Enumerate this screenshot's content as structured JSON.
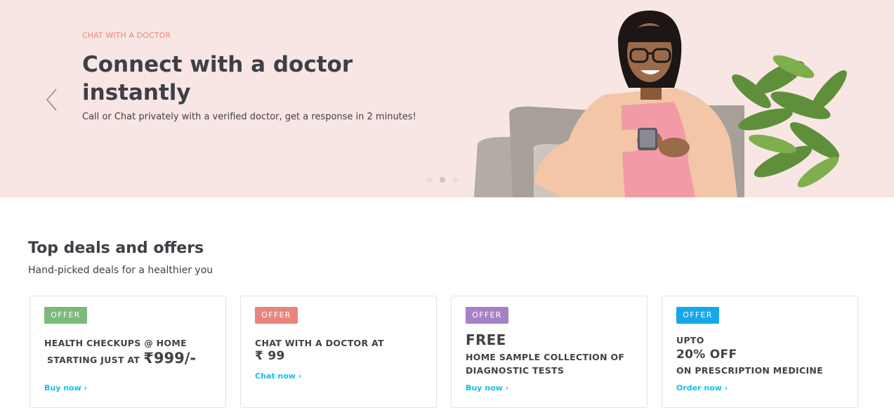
{
  "hero": {
    "eyebrow": "CHAT WITH A DOCTOR",
    "title": "Connect with a doctor instantly",
    "subtitle": "Call or Chat privately with a verified doctor, get a response in 2 minutes!",
    "prev_icon": "chevron-left-icon",
    "slides": 3,
    "active_slide": 2,
    "colors": {
      "background": "#f8e6e4",
      "eyebrow": "#e8867d"
    }
  },
  "deals": {
    "title": "Top deals and offers",
    "subtitle": "Hand-picked deals for a healthier you",
    "cards": [
      {
        "badge": "OFFER",
        "badge_color": "#7cb97c",
        "line1": "HEALTH CHECKUPS @ HOME",
        "line2": "STARTING JUST AT",
        "price": "₹999/-",
        "cta": "Buy now"
      },
      {
        "badge": "OFFER",
        "badge_color": "#e8867d",
        "line1": "CHAT WITH A DOCTOR AT",
        "price": "₹ 99",
        "cta": "Chat now"
      },
      {
        "badge": "OFFER",
        "badge_color": "#a682c4",
        "headline": "FREE",
        "line1": "HOME SAMPLE COLLECTION OF",
        "line2": "DIAGNOSTIC TESTS",
        "cta": "Buy now"
      },
      {
        "badge": "OFFER",
        "badge_color": "#14a8ea",
        "line1": "UPTO",
        "headline": "20% OFF",
        "line2": "ON PRESCRIPTION MEDICINE",
        "cta": "Order now"
      }
    ],
    "cta_color": "#14bef0"
  }
}
